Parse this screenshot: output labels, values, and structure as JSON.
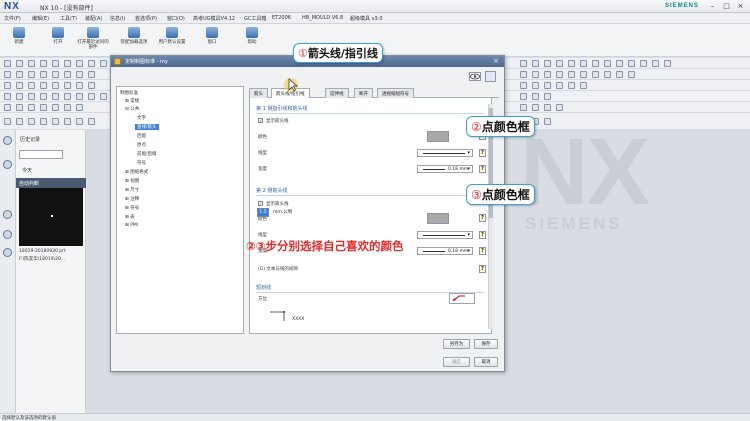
{
  "window": {
    "logo": "NX",
    "title": "NX 10 - [没有部件]",
    "brand": "SIEMENS",
    "controls": [
      "–",
      "□",
      "×"
    ]
  },
  "menubar": [
    "文件(F)",
    "编辑(E)",
    "工具(T)",
    "装配(A)",
    "信息(I)",
    "首选项(P)",
    "窗口(O)",
    "高考UG模具V4.12",
    "GC工具箱",
    "ET2006",
    "HB_MOULD V6.8",
    "超级模具 v3.0"
  ],
  "ribbon": {
    "buttons": [
      {
        "label": "新建"
      },
      {
        "label": "打开"
      },
      {
        "label": "打开最近访问的部件"
      },
      {
        "label": "装配加载选项"
      },
      {
        "label": "用户默认设置"
      },
      {
        "label": "窗口"
      },
      {
        "label": "帮助"
      }
    ]
  },
  "history": {
    "title": "历史记录",
    "today": "今天",
    "auto_label": "自动判断",
    "file_line1": "18019-20180930.prt",
    "file_line2": "F:\\陈友华\\18019\\20..."
  },
  "watermark": {
    "nx": "NX",
    "siemens": "SIEMENS"
  },
  "statusbar": {
    "text": "选择默认及该选项的默认值"
  },
  "dialog": {
    "title": "定制制图标准 - my",
    "close": "×",
    "tree": [
      {
        "label": "制图标准",
        "level": 0
      },
      {
        "label": "常规",
        "level": 1
      },
      {
        "label": "公共",
        "level": 1
      },
      {
        "label": "文字",
        "level": 2
      },
      {
        "label": "直线/箭头",
        "level": 2,
        "selected": true
      },
      {
        "label": "后缀",
        "level": 2
      },
      {
        "label": "原点",
        "level": 2
      },
      {
        "label": "前缀/后缀",
        "level": 2
      },
      {
        "label": "符号",
        "level": 2
      },
      {
        "label": "图纸格式",
        "level": 1
      },
      {
        "label": "视图",
        "level": 1
      },
      {
        "label": "尺寸",
        "level": 1
      },
      {
        "label": "注释",
        "level": 1
      },
      {
        "label": "符号",
        "level": 1
      },
      {
        "label": "表",
        "level": 1
      },
      {
        "label": "PMI",
        "level": 1
      }
    ],
    "tabs": [
      {
        "label": "箭头",
        "active": false
      },
      {
        "label": "箭头线/指引线",
        "active": true
      },
      {
        "label": "延伸线",
        "active": false
      },
      {
        "label": "断开",
        "active": false
      },
      {
        "label": "透视缩短符号",
        "active": false
      }
    ],
    "section1": {
      "heading": "第 1 侧指引线和箭头线",
      "checkbox_label": "显示箭头线",
      "color_label": "颜色",
      "color_value": "#a9a9a9",
      "line_label": "线型",
      "width_label": "宽度",
      "width_value": "0.18 mm"
    },
    "section2": {
      "heading": "第 2 侧箭头线",
      "checkbox_label": "显示箭头线",
      "color_label": "颜色",
      "color_value": "#a9a9a9",
      "line_label": "线型",
      "width_label": "宽度",
      "width_value": "0.18 mm"
    },
    "gap": {
      "label": "(G) 文本与线的间隙",
      "value": "1.5",
      "unit": "mm 公制"
    },
    "short_line": {
      "heading": "短划线",
      "orient_label": "方位",
      "sample_text": "XXXX"
    },
    "checkmark": "✓",
    "help_glyph": "?",
    "dropdown_glyph": "▾",
    "buttons": {
      "save_as": "另存为",
      "save": "保存",
      "ok": "确定",
      "cancel": "取消"
    }
  },
  "annotations": {
    "callout1": {
      "num": "①",
      "text": "箭头线/指引线"
    },
    "callout2": {
      "num": "②",
      "text": "点颜色框"
    },
    "callout3": {
      "num": "③",
      "text": "点颜色框"
    },
    "note": "②③步分别选择自己喜欢的颜色"
  }
}
